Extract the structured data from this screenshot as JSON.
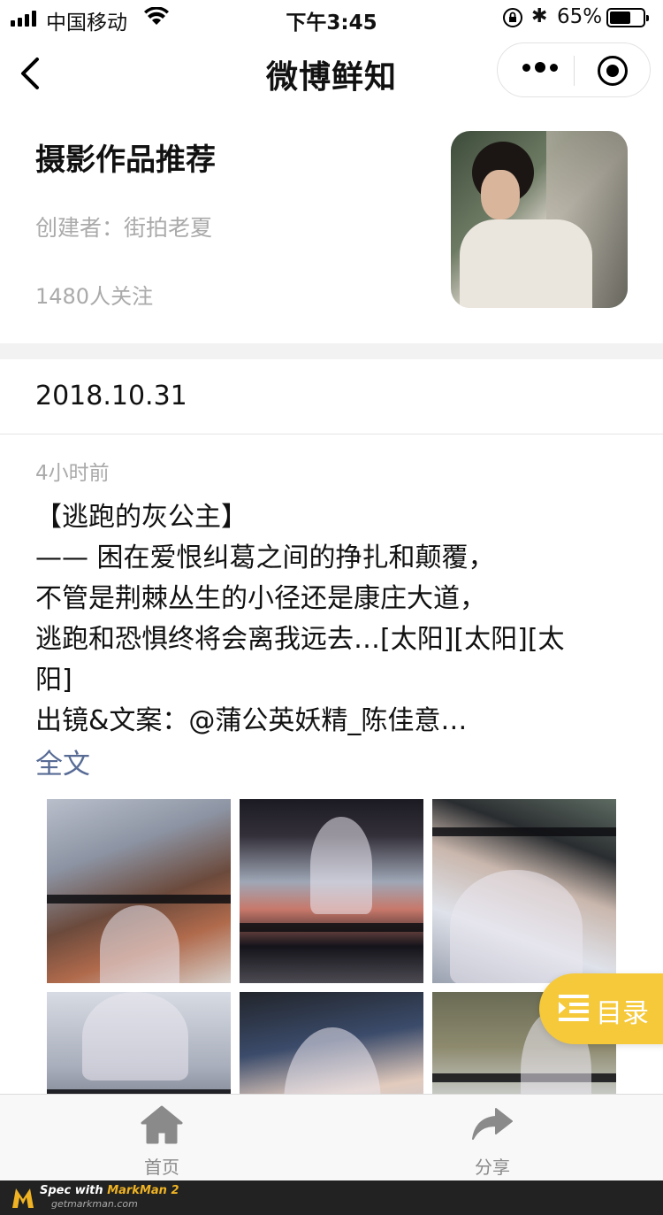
{
  "status_bar": {
    "carrier": "中国移动",
    "time": "下午3:45",
    "battery": "65%",
    "battery_level": 0.65
  },
  "nav": {
    "title": "微博鲜知",
    "more_icon": "ellipsis-icon",
    "close_icon": "target-close-icon"
  },
  "header": {
    "title": "摄影作品推荐",
    "creator": "创建者：街拍老夏",
    "followers": "1480人关注"
  },
  "section_date": "2018.10.31",
  "post": {
    "time_ago": "4小时前",
    "lines": [
      "【逃跑的灰公主】",
      "—— 困在爱恨纠葛之间的挣扎和颠覆，",
      "不管是荆棘丛生的小径还是康庄大道，",
      "逃跑和恐惧终将会离我远去…[太阳][太阳][太",
      "阳]",
      "出镜&文案：@蒲公英妖精_陈佳意…"
    ],
    "full_text_link": "全文"
  },
  "floating_button": {
    "label": "目录",
    "icon": "menu-list-icon"
  },
  "tabbar": {
    "home": "首页",
    "share": "分享"
  },
  "footer": {
    "brand_prefix": "Spec with ",
    "brand_name": "MarkMan 2",
    "site": "getmarkman.com"
  }
}
